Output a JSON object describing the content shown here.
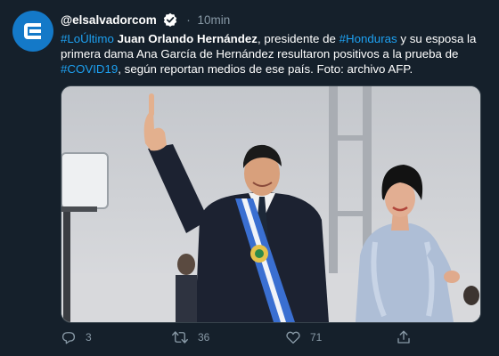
{
  "tweet": {
    "handle": "@elsalvadorcom",
    "separator": "·",
    "time": "10min",
    "text": {
      "hashtag1": "#LoÚltimo",
      "name": "Juan Orlando Hernández",
      "part1": ", presidente de ",
      "hashtag2": "#Honduras",
      "part2": " y su esposa la primera dama Ana García de Hernández resultaron positivos a la prueba de ",
      "hashtag3": "#COVID19",
      "part3": ", según reportan medios de ese país. Foto: archivo AFP."
    },
    "actions": {
      "reply_count": "3",
      "retweet_count": "36",
      "like_count": "71"
    }
  },
  "icons": {
    "avatar": "elsalvador-logo-icon",
    "verified": "verified-badge-icon",
    "reply": "reply-icon",
    "retweet": "retweet-icon",
    "like": "heart-icon",
    "share": "share-icon"
  },
  "colors": {
    "background": "#15202b",
    "link": "#1da1f2",
    "muted": "#8899a6",
    "avatar": "#1479c8"
  }
}
